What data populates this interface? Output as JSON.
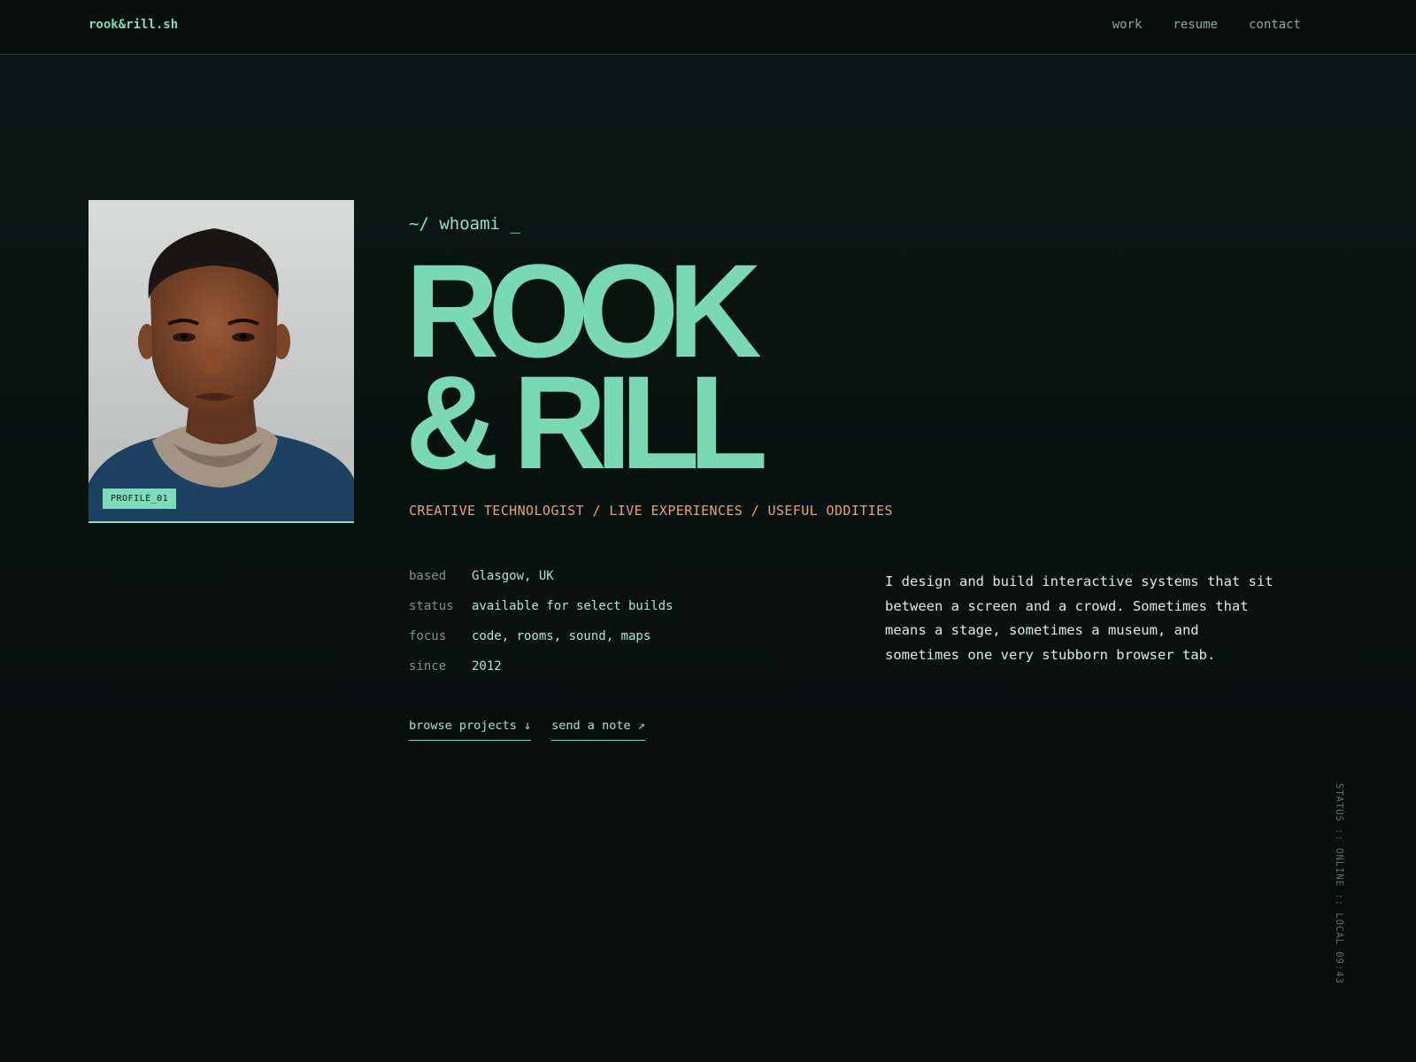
{
  "header": {
    "brand": "rook&rill.sh",
    "nav": [
      {
        "label": "work"
      },
      {
        "label": "resume"
      },
      {
        "label": "contact"
      }
    ]
  },
  "profile": {
    "tag": "PROFILE_01"
  },
  "hero": {
    "prompt": "~/ whoami _",
    "name_line1": "ROOK",
    "name_line2": "& RILL",
    "tagline": "CREATIVE TECHNOLOGIST / LIVE EXPERIENCES / USEFUL ODDITIES"
  },
  "facts": [
    {
      "key": "based",
      "value": "Glasgow, UK"
    },
    {
      "key": "status",
      "value": "available for select builds"
    },
    {
      "key": "focus",
      "value": "code, rooms, sound, maps"
    },
    {
      "key": "since",
      "value": "2012"
    }
  ],
  "bio": "I design and build interactive systems that sit between a screen and a crowd. Sometimes that means a stage, sometimes a museum, and sometimes one very stubborn browser tab.",
  "actions": {
    "browse": "browse projects ↓",
    "note": "send a note ↗"
  },
  "status_line": "STATUS :: ONLINE :: LOCAL 09:43",
  "colors": {
    "accent": "#79d9b5",
    "tagline": "#e6a36b",
    "background": "#07110e"
  }
}
